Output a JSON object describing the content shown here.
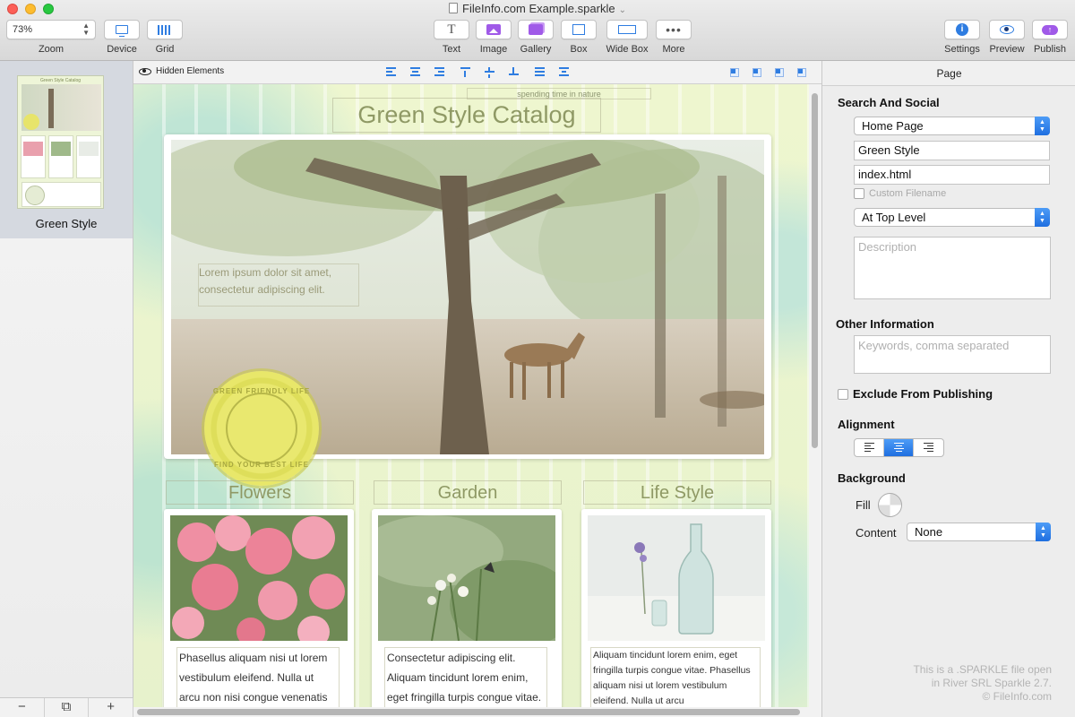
{
  "window": {
    "title": "FileInfo.com Example.sparkle"
  },
  "toolbar": {
    "zoom_value": "73%",
    "zoom_label": "Zoom",
    "device_label": "Device",
    "grid_label": "Grid",
    "text_label": "Text",
    "image_label": "Image",
    "gallery_label": "Gallery",
    "box_label": "Box",
    "widebox_label": "Wide Box",
    "more_label": "More",
    "settings_label": "Settings",
    "preview_label": "Preview",
    "publish_label": "Publish"
  },
  "pages": {
    "items": [
      {
        "label": "Green Style"
      }
    ]
  },
  "canvas_bar": {
    "hidden_elements": "Hidden Elements"
  },
  "site": {
    "subtitle": "spending time in nature",
    "title": "Green Style Catalog",
    "hero_text": "Lorem ipsum dolor sit amet, consectetur adipiscing elit.",
    "seal_top": "GREEN FRIENDLY LIFE",
    "seal_bottom": "FIND YOUR BEST LIFE",
    "columns": [
      {
        "title": "Flowers",
        "text": "Phasellus aliquam nisi ut lorem vestibulum eleifend. Nulla ut arcu non nisi congue venenatis vitae ut"
      },
      {
        "title": "Garden",
        "text": "Consectetur adipiscing elit. Aliquam tincidunt lorem enim, eget fringilla turpis congue vitae."
      },
      {
        "title": "Life Style",
        "text": "Aliquam tincidunt lorem enim, eget fringilla turpis congue vitae. Phasellus aliquam nisi ut lorem vestibulum eleifend. Nulla ut arcu"
      }
    ]
  },
  "inspector": {
    "header": "Page",
    "search_social": "Search And Social",
    "page_type": "Home Page",
    "page_title": "Green Style",
    "filename": "index.html",
    "custom_filename": "Custom Filename",
    "level": "At Top Level",
    "description_placeholder": "Description",
    "other_info": "Other Information",
    "keywords_placeholder": "Keywords, comma separated",
    "exclude": "Exclude From Publishing",
    "alignment": "Alignment",
    "background": "Background",
    "fill": "Fill",
    "content": "Content",
    "content_value": "None",
    "watermark": [
      "This is a .SPARKLE file open",
      "in River SRL Sparkle 2.7.",
      "© FileInfo.com"
    ]
  }
}
